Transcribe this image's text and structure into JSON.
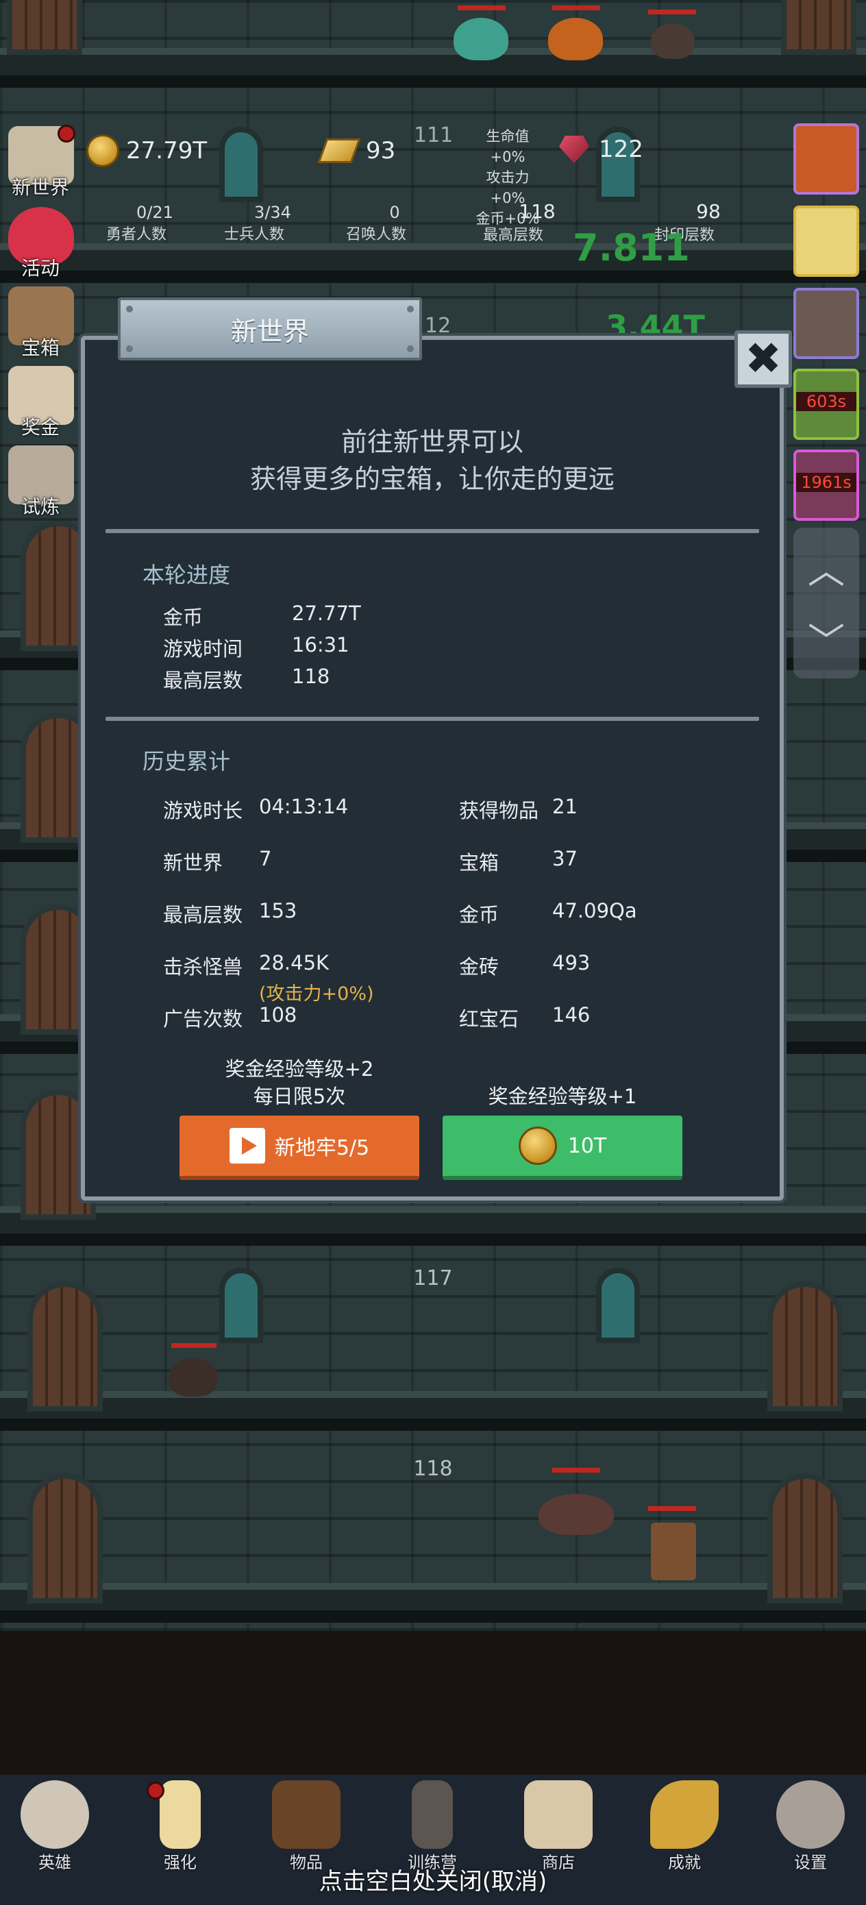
{
  "hud": {
    "gold": "27.79T",
    "gold_bars": "93",
    "level_hint": "111",
    "bonus_hp": "生命值+0%",
    "bonus_atk": "攻击力+0%",
    "bonus_gold": "金币+0%",
    "rubies": "122",
    "heroes_value": "0/21",
    "heroes_label": "勇者人数",
    "soldiers_value": "3/34",
    "soldiers_label": "士兵人数",
    "summons_value": "0",
    "summons_label": "召唤人数",
    "max_floor_value": "118",
    "max_floor_label": "最高层数",
    "sealed_value": "98",
    "sealed_label": "封印层数",
    "green_float_1": "7.811",
    "green_float_2": "3.44T",
    "bg_floor_number": "12"
  },
  "side_menu": [
    {
      "label": "新世界"
    },
    {
      "label": "活动"
    },
    {
      "label": "宝箱"
    },
    {
      "label": "奖金"
    },
    {
      "label": "试炼"
    }
  ],
  "right_timers": {
    "timer_1": "603s",
    "timer_2": "1961s"
  },
  "modal": {
    "title": "新世界",
    "close_icon": "✖",
    "headline_line1": "前往新世界可以",
    "headline_line2": "获得更多的宝箱，让你走的更远",
    "current": {
      "title": "本轮进度",
      "rows": [
        {
          "label": "金币",
          "value": "27.77T"
        },
        {
          "label": "游戏时间",
          "value": "16:31"
        },
        {
          "label": "最高层数",
          "value": "118"
        }
      ]
    },
    "history": {
      "title": "历史累计",
      "left": [
        {
          "label": "游戏时长",
          "value": "04:13:14"
        },
        {
          "label": "新世界",
          "value": "7"
        },
        {
          "label": "最高层数",
          "value": "153"
        },
        {
          "label": "击杀怪兽",
          "value": "28.45K"
        },
        {
          "label": "广告次数",
          "value": "108"
        }
      ],
      "kill_note": "(攻击力+0%)",
      "right": [
        {
          "label": "获得物品",
          "value": "21"
        },
        {
          "label": "宝箱",
          "value": "37"
        },
        {
          "label": "金币",
          "value": "47.09Qa"
        },
        {
          "label": "金砖",
          "value": "493"
        },
        {
          "label": "红宝石",
          "value": "146"
        }
      ]
    },
    "ad_caption_line1": "奖金经验等级+2",
    "ad_caption_line2": "每日限5次",
    "ad_button": "新地牢5/5",
    "gold_caption": "奖金经验等级+1",
    "gold_button": "10T"
  },
  "floors": {
    "floor_a": "117",
    "floor_b": "118"
  },
  "bottom_nav": [
    {
      "label": "英雄"
    },
    {
      "label": "强化"
    },
    {
      "label": "物品"
    },
    {
      "label": "训练营"
    },
    {
      "label": "商店"
    },
    {
      "label": "成就"
    },
    {
      "label": "设置"
    }
  ],
  "close_hint": "点击空白处关闭(取消)"
}
